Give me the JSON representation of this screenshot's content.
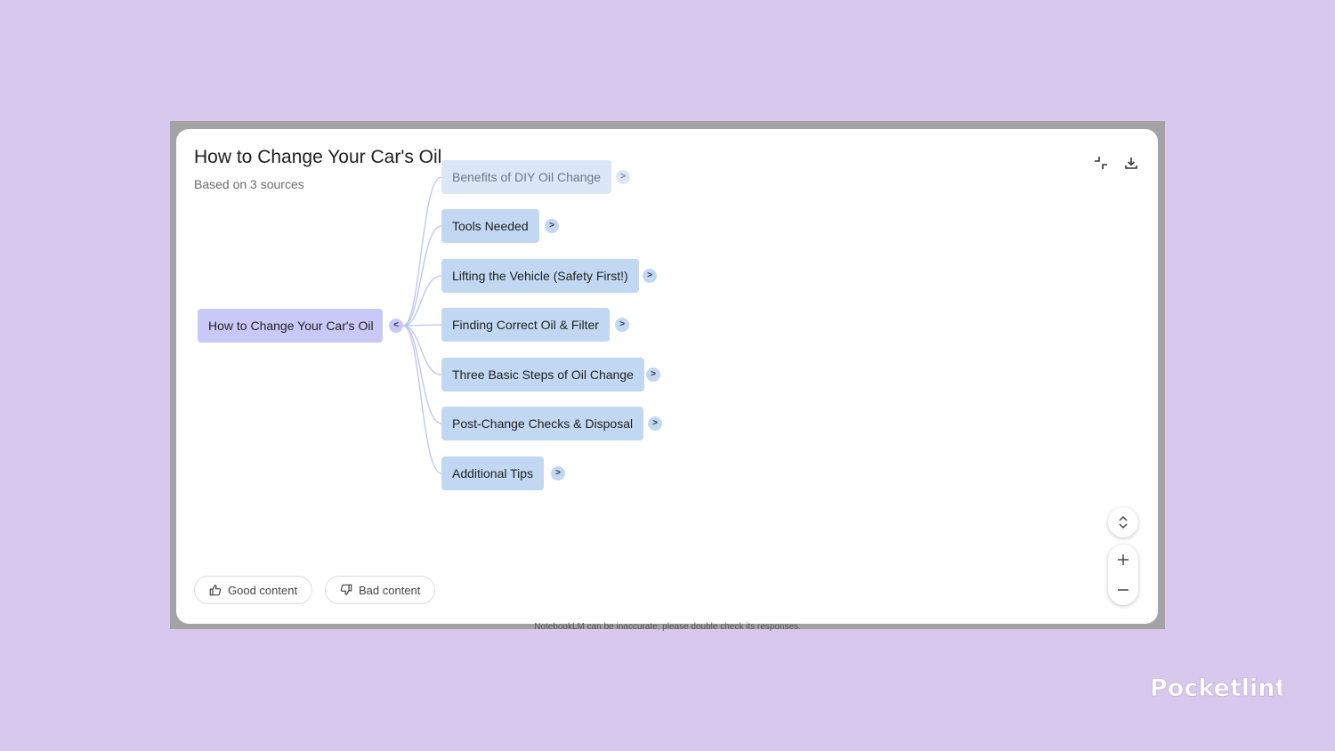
{
  "mindmap": {
    "title": "How to Change Your Car's Oil",
    "subtitle": "Based on 3 sources",
    "root": {
      "label": "How to Change Your Car's Oil",
      "toggle": "<"
    },
    "children": [
      {
        "label": "Benefits of DIY Oil Change",
        "toggle": ">"
      },
      {
        "label": "Tools Needed",
        "toggle": ">"
      },
      {
        "label": "Lifting the Vehicle (Safety First!)",
        "toggle": ">"
      },
      {
        "label": "Finding Correct Oil & Filter",
        "toggle": ">"
      },
      {
        "label": "Three Basic Steps of Oil Change",
        "toggle": ">"
      },
      {
        "label": "Post-Change Checks & Disposal",
        "toggle": ">"
      },
      {
        "label": "Additional Tips",
        "toggle": ">"
      }
    ]
  },
  "feedback": {
    "good_label": "Good content",
    "bad_label": "Bad content"
  },
  "footer": {
    "disclaimer": "NotebookLM can be inaccurate; please double check its responses."
  },
  "watermark": {
    "text": "Pocketlint"
  },
  "colors": {
    "background": "#d8c8ee",
    "root_node": "#c9c9f7",
    "child_node": "#c2d8f2",
    "edge": "#b9c6ef"
  },
  "icons": {
    "collapse": "collapse-icon",
    "download": "download-icon",
    "expand_vertical": "unfold-icon",
    "zoom_in": "plus-icon",
    "zoom_out": "minus-icon",
    "thumbs_up": "thumbs-up-icon",
    "thumbs_down": "thumbs-down-icon"
  }
}
